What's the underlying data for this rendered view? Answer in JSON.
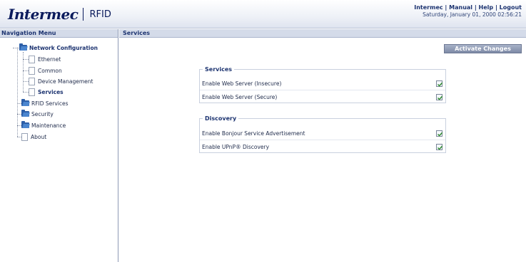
{
  "header": {
    "logo_text": "Intermec",
    "product": "RFID",
    "links": [
      "Intermec",
      "Manual",
      "Help",
      "Logout"
    ],
    "separator": "|",
    "datetime": "Saturday, January 01, 2000 02:56:21"
  },
  "nav": {
    "title": "Navigation Menu",
    "items": [
      {
        "label": "Network Configuration",
        "icon": "folder-open-icon"
      },
      {
        "label": "Ethernet",
        "icon": "page-icon"
      },
      {
        "label": "Common",
        "icon": "page-icon"
      },
      {
        "label": "Device Management",
        "icon": "page-icon"
      },
      {
        "label": "Services",
        "icon": "page-icon"
      },
      {
        "label": "RFID Services",
        "icon": "folder-icon"
      },
      {
        "label": "Security",
        "icon": "folder-icon"
      },
      {
        "label": "Maintenance",
        "icon": "folder-icon"
      },
      {
        "label": "About",
        "icon": "page-icon"
      }
    ]
  },
  "main": {
    "title": "Services",
    "activate_label": "Activate Changes",
    "groups": [
      {
        "legend": "Services",
        "rows": [
          {
            "label": "Enable Web Server (Insecure)",
            "checked": true
          },
          {
            "label": "Enable Web Server (Secure)",
            "checked": true
          }
        ]
      },
      {
        "legend": "Discovery",
        "rows": [
          {
            "label": "Enable Bonjour Service Advertisement",
            "checked": true
          },
          {
            "label": "Enable UPnP® Discovery",
            "checked": true
          }
        ]
      }
    ]
  },
  "colors": {
    "brand": "#0a1a5c",
    "titlebar": "#d4dbe9",
    "button": "#8c97b1",
    "check": "#2e8b2e"
  }
}
